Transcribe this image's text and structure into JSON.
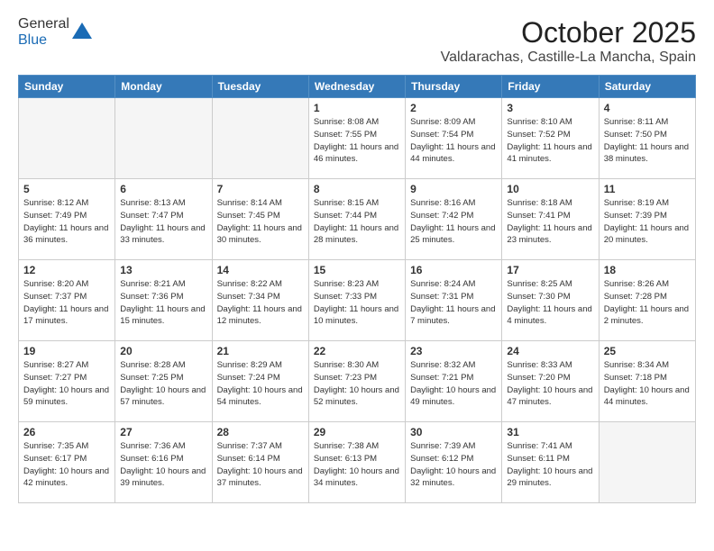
{
  "header": {
    "logo_general": "General",
    "logo_blue": "Blue",
    "month": "October 2025",
    "location": "Valdarachas, Castille-La Mancha, Spain"
  },
  "weekdays": [
    "Sunday",
    "Monday",
    "Tuesday",
    "Wednesday",
    "Thursday",
    "Friday",
    "Saturday"
  ],
  "weeks": [
    [
      {
        "day": "",
        "info": ""
      },
      {
        "day": "",
        "info": ""
      },
      {
        "day": "",
        "info": ""
      },
      {
        "day": "1",
        "info": "Sunrise: 8:08 AM\nSunset: 7:55 PM\nDaylight: 11 hours\nand 46 minutes."
      },
      {
        "day": "2",
        "info": "Sunrise: 8:09 AM\nSunset: 7:54 PM\nDaylight: 11 hours\nand 44 minutes."
      },
      {
        "day": "3",
        "info": "Sunrise: 8:10 AM\nSunset: 7:52 PM\nDaylight: 11 hours\nand 41 minutes."
      },
      {
        "day": "4",
        "info": "Sunrise: 8:11 AM\nSunset: 7:50 PM\nDaylight: 11 hours\nand 38 minutes."
      }
    ],
    [
      {
        "day": "5",
        "info": "Sunrise: 8:12 AM\nSunset: 7:49 PM\nDaylight: 11 hours\nand 36 minutes."
      },
      {
        "day": "6",
        "info": "Sunrise: 8:13 AM\nSunset: 7:47 PM\nDaylight: 11 hours\nand 33 minutes."
      },
      {
        "day": "7",
        "info": "Sunrise: 8:14 AM\nSunset: 7:45 PM\nDaylight: 11 hours\nand 30 minutes."
      },
      {
        "day": "8",
        "info": "Sunrise: 8:15 AM\nSunset: 7:44 PM\nDaylight: 11 hours\nand 28 minutes."
      },
      {
        "day": "9",
        "info": "Sunrise: 8:16 AM\nSunset: 7:42 PM\nDaylight: 11 hours\nand 25 minutes."
      },
      {
        "day": "10",
        "info": "Sunrise: 8:18 AM\nSunset: 7:41 PM\nDaylight: 11 hours\nand 23 minutes."
      },
      {
        "day": "11",
        "info": "Sunrise: 8:19 AM\nSunset: 7:39 PM\nDaylight: 11 hours\nand 20 minutes."
      }
    ],
    [
      {
        "day": "12",
        "info": "Sunrise: 8:20 AM\nSunset: 7:37 PM\nDaylight: 11 hours\nand 17 minutes."
      },
      {
        "day": "13",
        "info": "Sunrise: 8:21 AM\nSunset: 7:36 PM\nDaylight: 11 hours\nand 15 minutes."
      },
      {
        "day": "14",
        "info": "Sunrise: 8:22 AM\nSunset: 7:34 PM\nDaylight: 11 hours\nand 12 minutes."
      },
      {
        "day": "15",
        "info": "Sunrise: 8:23 AM\nSunset: 7:33 PM\nDaylight: 11 hours\nand 10 minutes."
      },
      {
        "day": "16",
        "info": "Sunrise: 8:24 AM\nSunset: 7:31 PM\nDaylight: 11 hours\nand 7 minutes."
      },
      {
        "day": "17",
        "info": "Sunrise: 8:25 AM\nSunset: 7:30 PM\nDaylight: 11 hours\nand 4 minutes."
      },
      {
        "day": "18",
        "info": "Sunrise: 8:26 AM\nSunset: 7:28 PM\nDaylight: 11 hours\nand 2 minutes."
      }
    ],
    [
      {
        "day": "19",
        "info": "Sunrise: 8:27 AM\nSunset: 7:27 PM\nDaylight: 10 hours\nand 59 minutes."
      },
      {
        "day": "20",
        "info": "Sunrise: 8:28 AM\nSunset: 7:25 PM\nDaylight: 10 hours\nand 57 minutes."
      },
      {
        "day": "21",
        "info": "Sunrise: 8:29 AM\nSunset: 7:24 PM\nDaylight: 10 hours\nand 54 minutes."
      },
      {
        "day": "22",
        "info": "Sunrise: 8:30 AM\nSunset: 7:23 PM\nDaylight: 10 hours\nand 52 minutes."
      },
      {
        "day": "23",
        "info": "Sunrise: 8:32 AM\nSunset: 7:21 PM\nDaylight: 10 hours\nand 49 minutes."
      },
      {
        "day": "24",
        "info": "Sunrise: 8:33 AM\nSunset: 7:20 PM\nDaylight: 10 hours\nand 47 minutes."
      },
      {
        "day": "25",
        "info": "Sunrise: 8:34 AM\nSunset: 7:18 PM\nDaylight: 10 hours\nand 44 minutes."
      }
    ],
    [
      {
        "day": "26",
        "info": "Sunrise: 7:35 AM\nSunset: 6:17 PM\nDaylight: 10 hours\nand 42 minutes."
      },
      {
        "day": "27",
        "info": "Sunrise: 7:36 AM\nSunset: 6:16 PM\nDaylight: 10 hours\nand 39 minutes."
      },
      {
        "day": "28",
        "info": "Sunrise: 7:37 AM\nSunset: 6:14 PM\nDaylight: 10 hours\nand 37 minutes."
      },
      {
        "day": "29",
        "info": "Sunrise: 7:38 AM\nSunset: 6:13 PM\nDaylight: 10 hours\nand 34 minutes."
      },
      {
        "day": "30",
        "info": "Sunrise: 7:39 AM\nSunset: 6:12 PM\nDaylight: 10 hours\nand 32 minutes."
      },
      {
        "day": "31",
        "info": "Sunrise: 7:41 AM\nSunset: 6:11 PM\nDaylight: 10 hours\nand 29 minutes."
      },
      {
        "day": "",
        "info": ""
      }
    ]
  ]
}
